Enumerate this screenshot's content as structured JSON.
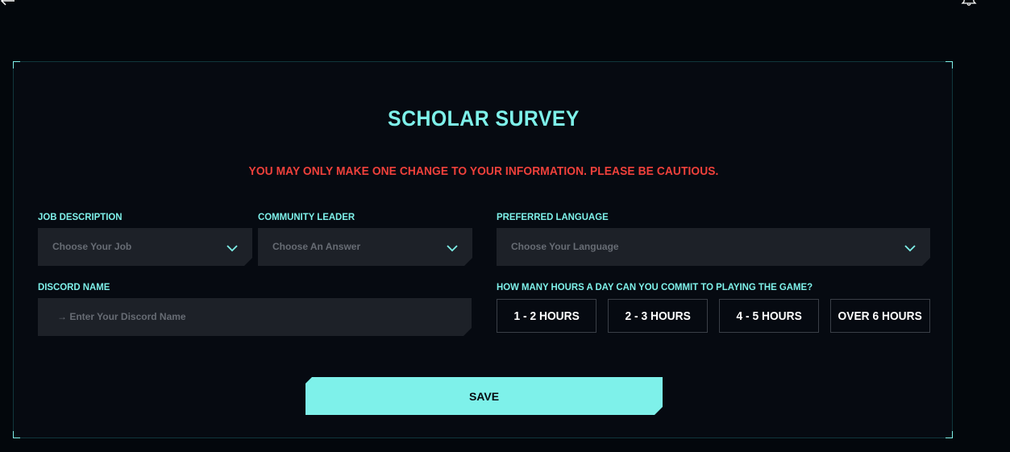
{
  "survey": {
    "title": "SCHOLAR SURVEY",
    "warning": "YOU MAY ONLY MAKE ONE CHANGE TO YOUR INFORMATION. PLEASE BE CAUTIOUS.",
    "job": {
      "label": "JOB DESCRIPTION",
      "placeholder": "Choose Your Job"
    },
    "community": {
      "label": "COMMUNITY LEADER",
      "placeholder": "Choose An Answer"
    },
    "language": {
      "label": "PREFERRED LANGUAGE",
      "placeholder": "Choose Your Language"
    },
    "discord": {
      "label": "DISCORD NAME",
      "placeholder": "→ Enter Your Discord Name"
    },
    "hours": {
      "label": "HOW MANY HOURS A DAY CAN YOU COMMIT TO PLAYING THE GAME?",
      "options": [
        "1 - 2 HOURS",
        "2 - 3 HOURS",
        "4 - 5 HOURS",
        "OVER 6 HOURS"
      ]
    },
    "save_label": "SAVE"
  },
  "colors": {
    "accent": "#7ef1ea",
    "warning": "#f0413b",
    "background": "#03070c",
    "card": "#060a11",
    "field": "#1d2128"
  },
  "icons": {
    "back": "arrow-left-icon",
    "notifications": "bell-icon",
    "dropdown": "chevron-down-icon"
  }
}
